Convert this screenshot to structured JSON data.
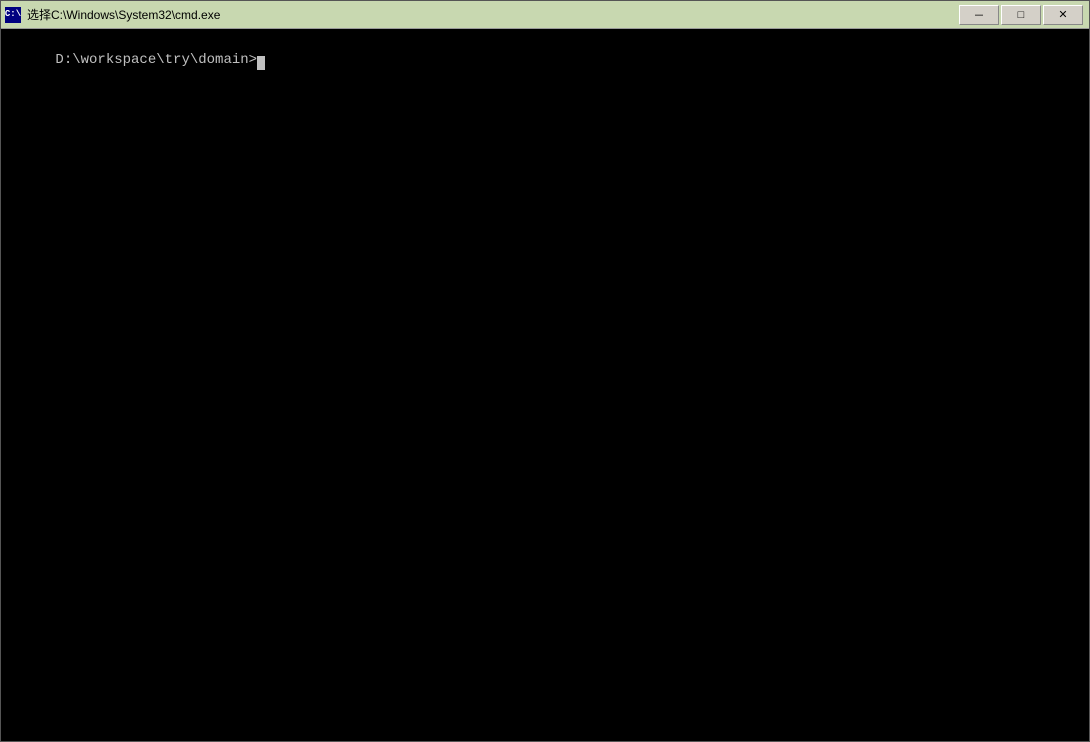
{
  "titlebar": {
    "title": "选择C:\\Windows\\System32\\cmd.exe",
    "icon_label": "C",
    "minimize_label": "－",
    "maximize_label": "□",
    "close_label": "✕"
  },
  "terminal": {
    "prompt": "D:\\workspace\\try\\domain>"
  }
}
